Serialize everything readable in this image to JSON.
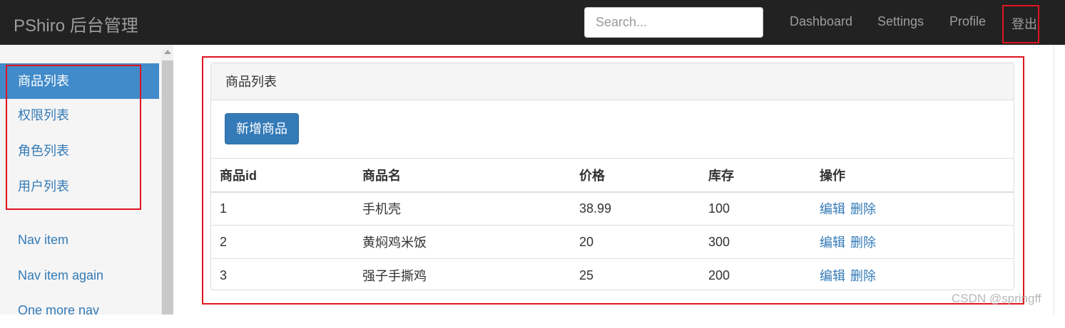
{
  "navbar": {
    "brand": "PShiro 后台管理",
    "search_placeholder": "Search...",
    "links": [
      "Dashboard",
      "Settings",
      "Profile"
    ],
    "logout_label": "登出"
  },
  "sidebar": {
    "items": [
      {
        "label": "商品列表",
        "active": true
      },
      {
        "label": "权限列表",
        "active": false
      },
      {
        "label": "角色列表",
        "active": false
      },
      {
        "label": "用户列表",
        "active": false
      }
    ],
    "extra_items": [
      "Nav item",
      "Nav item again",
      "One more nav"
    ]
  },
  "panel": {
    "heading": "商品列表",
    "add_button": "新增商品",
    "columns": [
      "商品id",
      "商品名",
      "价格",
      "库存",
      "操作"
    ],
    "rows": [
      {
        "id": "1",
        "name": "手机壳",
        "price": "38.99",
        "stock": "100"
      },
      {
        "id": "2",
        "name": "黄焖鸡米饭",
        "price": "20",
        "stock": "300"
      },
      {
        "id": "3",
        "name": "强子手撕鸡",
        "price": "25",
        "stock": "200"
      }
    ],
    "actions": {
      "edit": "编辑",
      "delete": "删除"
    }
  },
  "watermark": "CSDN @springff",
  "colors": {
    "navbar_bg": "#222222",
    "primary": "#337ab7",
    "active_item": "#428bca",
    "highlight_border": "#e0141e"
  }
}
